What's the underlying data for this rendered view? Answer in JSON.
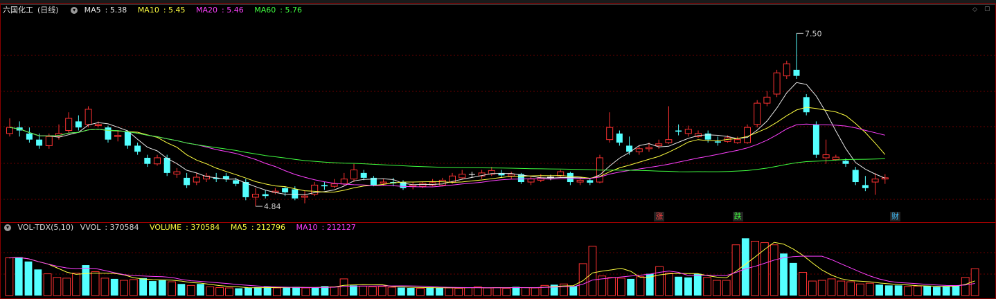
{
  "chart_data": [
    {
      "type": "candlestick",
      "stock_name": "六国化工",
      "period": "(日线)",
      "indicators": [
        {
          "name": "MA5",
          "value": "5.38",
          "color": "#e8e8e8"
        },
        {
          "name": "MA10",
          "value": "5.45",
          "color": "#ffff40"
        },
        {
          "name": "MA20",
          "value": "5.46",
          "color": "#ff40ff"
        },
        {
          "name": "MA60",
          "value": "5.76",
          "color": "#40ff40"
        }
      ],
      "ylim": [
        4.4,
        7.8
      ],
      "annotations": {
        "high": "7.50",
        "low": "4.84"
      },
      "event_tags": [
        {
          "label": "涨",
          "bar_index": 66,
          "color": "#ff4040"
        },
        {
          "label": "跌",
          "bar_index": 74,
          "color": "#40ff40"
        },
        {
          "label": "财",
          "bar_index": 90,
          "color": "#40c0ff"
        }
      ],
      "colors": {
        "up": "#ff3232",
        "down": "#54ffff",
        "doji": "#ffffff"
      },
      "ohlc": [
        [
          5.85,
          5.95,
          6.1,
          5.8
        ],
        [
          5.95,
          5.9,
          6.05,
          5.8
        ],
        [
          5.85,
          5.75,
          5.95,
          5.7
        ],
        [
          5.75,
          5.65,
          5.85,
          5.6
        ],
        [
          5.65,
          5.8,
          5.85,
          5.6
        ],
        [
          5.8,
          5.85,
          6.0,
          5.75
        ],
        [
          5.9,
          6.1,
          6.2,
          5.85
        ],
        [
          6.05,
          5.95,
          6.15,
          5.9
        ],
        [
          6.0,
          6.25,
          6.3,
          5.95
        ],
        [
          5.98,
          6.0,
          6.05,
          5.95
        ],
        [
          5.95,
          5.75,
          5.98,
          5.7
        ],
        [
          5.8,
          5.82,
          5.9,
          5.72
        ],
        [
          5.88,
          5.65,
          5.9,
          5.6
        ],
        [
          5.65,
          5.55,
          5.7,
          5.5
        ],
        [
          5.45,
          5.35,
          5.5,
          5.3
        ],
        [
          5.35,
          5.45,
          5.5,
          5.32
        ],
        [
          5.45,
          5.2,
          5.5,
          5.15
        ],
        [
          5.18,
          5.22,
          5.28,
          5.12
        ],
        [
          5.12,
          5.0,
          5.2,
          4.95
        ],
        [
          5.05,
          5.13,
          5.2,
          5.0
        ],
        [
          5.1,
          5.15,
          5.2,
          5.05
        ],
        [
          5.12,
          5.1,
          5.2,
          5.05
        ],
        [
          5.15,
          5.1,
          5.2,
          5.05
        ],
        [
          5.08,
          5.02,
          5.12,
          4.98
        ],
        [
          5.05,
          4.8,
          5.1,
          4.75
        ],
        [
          4.8,
          4.85,
          4.95,
          4.65
        ],
        [
          4.85,
          4.82,
          4.92,
          4.78
        ],
        [
          4.88,
          4.9,
          4.95,
          4.85
        ],
        [
          4.95,
          4.88,
          4.98,
          4.82
        ],
        [
          4.93,
          4.78,
          4.98,
          4.75
        ],
        [
          4.8,
          4.82,
          4.9,
          4.7
        ],
        [
          4.85,
          5.0,
          5.05,
          4.82
        ],
        [
          5.0,
          4.98,
          5.05,
          4.92
        ],
        [
          4.98,
          5.02,
          5.1,
          4.95
        ],
        [
          5.02,
          5.1,
          5.2,
          4.98
        ],
        [
          5.1,
          5.25,
          5.35,
          5.05
        ],
        [
          5.2,
          5.12,
          5.25,
          5.08
        ],
        [
          5.12,
          5.0,
          5.15,
          4.98
        ],
        [
          5.03,
          5.05,
          5.1,
          5.0
        ],
        [
          5.05,
          5.03,
          5.12,
          4.98
        ],
        [
          5.05,
          4.95,
          5.08,
          4.92
        ],
        [
          4.98,
          5.0,
          5.05,
          4.93
        ],
        [
          4.98,
          5.03,
          5.06,
          4.95
        ],
        [
          5.0,
          5.04,
          5.1,
          4.98
        ],
        [
          5.0,
          5.08,
          5.12,
          4.98
        ],
        [
          5.05,
          5.15,
          5.2,
          5.02
        ],
        [
          5.12,
          5.18,
          5.25,
          5.1
        ],
        [
          5.18,
          5.18,
          5.22,
          5.12
        ],
        [
          5.15,
          5.2,
          5.25,
          5.1
        ],
        [
          5.18,
          5.24,
          5.3,
          5.15
        ],
        [
          5.2,
          5.16,
          5.25,
          5.12
        ],
        [
          5.15,
          5.18,
          5.22,
          5.1
        ],
        [
          5.18,
          5.05,
          5.2,
          5.02
        ],
        [
          5.05,
          5.1,
          5.15,
          5.0
        ],
        [
          5.08,
          5.12,
          5.18,
          5.05
        ],
        [
          5.12,
          5.13,
          5.17,
          5.08
        ],
        [
          5.15,
          5.22,
          5.25,
          5.12
        ],
        [
          5.2,
          5.05,
          5.22,
          5.0
        ],
        [
          5.05,
          5.08,
          5.12,
          5.0
        ],
        [
          5.08,
          5.04,
          5.1,
          5.0
        ],
        [
          5.05,
          5.45,
          5.5,
          5.03
        ],
        [
          5.75,
          5.95,
          6.2,
          5.7
        ],
        [
          5.85,
          5.7,
          5.9,
          5.65
        ],
        [
          5.65,
          5.55,
          5.8,
          5.5
        ],
        [
          5.55,
          5.6,
          5.65,
          5.5
        ],
        [
          5.6,
          5.62,
          5.7,
          5.55
        ],
        [
          5.65,
          5.68,
          5.75,
          5.6
        ],
        [
          5.7,
          5.75,
          6.3,
          5.68
        ],
        [
          5.9,
          5.88,
          6.0,
          5.82
        ],
        [
          5.85,
          5.92,
          5.98,
          5.8
        ],
        [
          5.8,
          5.85,
          5.9,
          5.78
        ],
        [
          5.85,
          5.75,
          5.9,
          5.7
        ],
        [
          5.72,
          5.7,
          5.8,
          5.65
        ],
        [
          5.72,
          5.78,
          5.82,
          5.7
        ],
        [
          5.7,
          5.75,
          5.8,
          5.68
        ],
        [
          5.7,
          5.95,
          6.0,
          5.68
        ],
        [
          6.0,
          6.35,
          6.4,
          5.95
        ],
        [
          6.35,
          6.45,
          6.55,
          6.3
        ],
        [
          6.5,
          6.85,
          6.9,
          6.45
        ],
        [
          6.8,
          7.0,
          7.05,
          6.75
        ],
        [
          6.9,
          6.8,
          7.5,
          6.75
        ],
        [
          6.45,
          6.2,
          6.5,
          6.15
        ],
        [
          6.0,
          5.5,
          6.05,
          5.45
        ],
        [
          5.45,
          5.5,
          5.75,
          5.35
        ],
        [
          5.42,
          5.46,
          5.5,
          5.4
        ],
        [
          5.4,
          5.35,
          5.44,
          5.3
        ],
        [
          5.25,
          5.05,
          5.3,
          5.0
        ],
        [
          5.0,
          4.95,
          5.15,
          4.9
        ],
        [
          5.05,
          5.1,
          5.2,
          4.84
        ],
        [
          5.1,
          5.12,
          5.18,
          5.02
        ]
      ]
    },
    {
      "type": "bar",
      "indicator_name": "VOL-TDX(5,10)",
      "vvol_label": "VVOL",
      "vvol_value": "370584",
      "volume_label": "VOLUME",
      "volume_value": "370584",
      "ma5_label": "MA5",
      "ma5_value": "212796",
      "ma10_label": "MA10",
      "ma10_value": "212127",
      "colors": {
        "volume": "#ffff40",
        "ma5": "#ffff40",
        "ma10": "#ff40ff"
      },
      "values": [
        520000,
        530000,
        470000,
        360000,
        300000,
        250000,
        240000,
        310000,
        420000,
        330000,
        240000,
        230000,
        210000,
        220000,
        240000,
        200000,
        210000,
        190000,
        160000,
        140000,
        160000,
        120000,
        110000,
        105000,
        100000,
        110000,
        115000,
        120000,
        105000,
        110000,
        120000,
        105000,
        115000,
        130000,
        120000,
        230000,
        140000,
        130000,
        120000,
        125000,
        115000,
        110000,
        105000,
        100000,
        115000,
        110000,
        105000,
        100000,
        110000,
        120000,
        105000,
        110000,
        100000,
        120000,
        110000,
        105000,
        140000,
        150000,
        160000,
        130000,
        440000,
        680000,
        270000,
        250000,
        240000,
        230000,
        260000,
        300000,
        400000,
        310000,
        260000,
        250000,
        300000,
        250000,
        210000,
        210000,
        700000,
        790000,
        750000,
        730000,
        700000,
        580000,
        450000,
        320000,
        200000,
        210000,
        230000,
        200000,
        190000,
        160000,
        170000,
        150000,
        140000,
        140000,
        125000,
        130000,
        130000,
        120000,
        130000,
        140000,
        250000,
        370584
      ],
      "up_flags_note": "",
      "ma5": [],
      "ma10": []
    }
  ]
}
